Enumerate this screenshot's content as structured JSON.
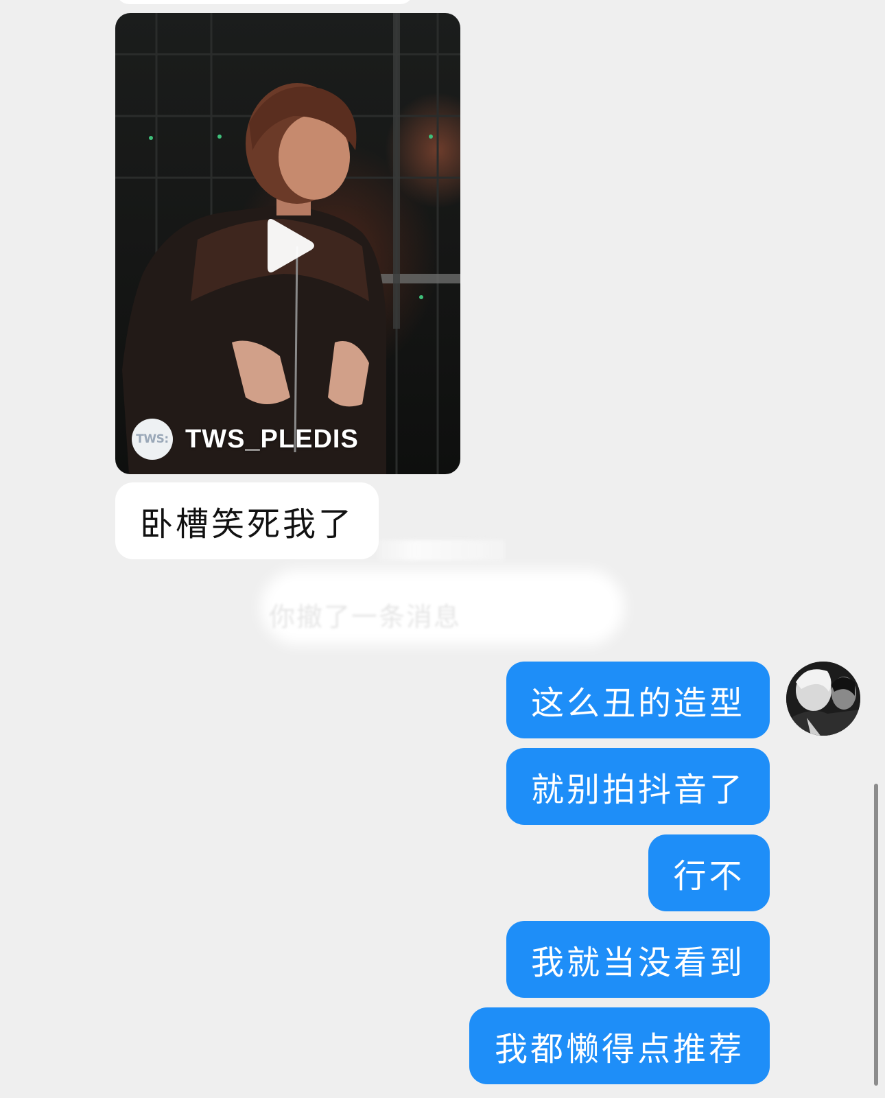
{
  "video_share": {
    "channel_logo_text": "TWS:",
    "channel_name": "TWS_PLEDIS",
    "play_icon": "play-icon"
  },
  "messages_incoming": [
    {
      "text": "卧槽笑死我了"
    }
  ],
  "hidden_notice": {
    "text": "你撤了一条消息"
  },
  "messages_outgoing": [
    {
      "text": "这么丑的造型"
    },
    {
      "text": "就别拍抖音了"
    },
    {
      "text": "行不"
    },
    {
      "text": "我就当没看到"
    },
    {
      "text": "我都懒得点推荐"
    }
  ],
  "colors": {
    "outgoing_bubble": "#1e8ef8",
    "incoming_bubble": "#ffffff",
    "background": "#efefef"
  }
}
